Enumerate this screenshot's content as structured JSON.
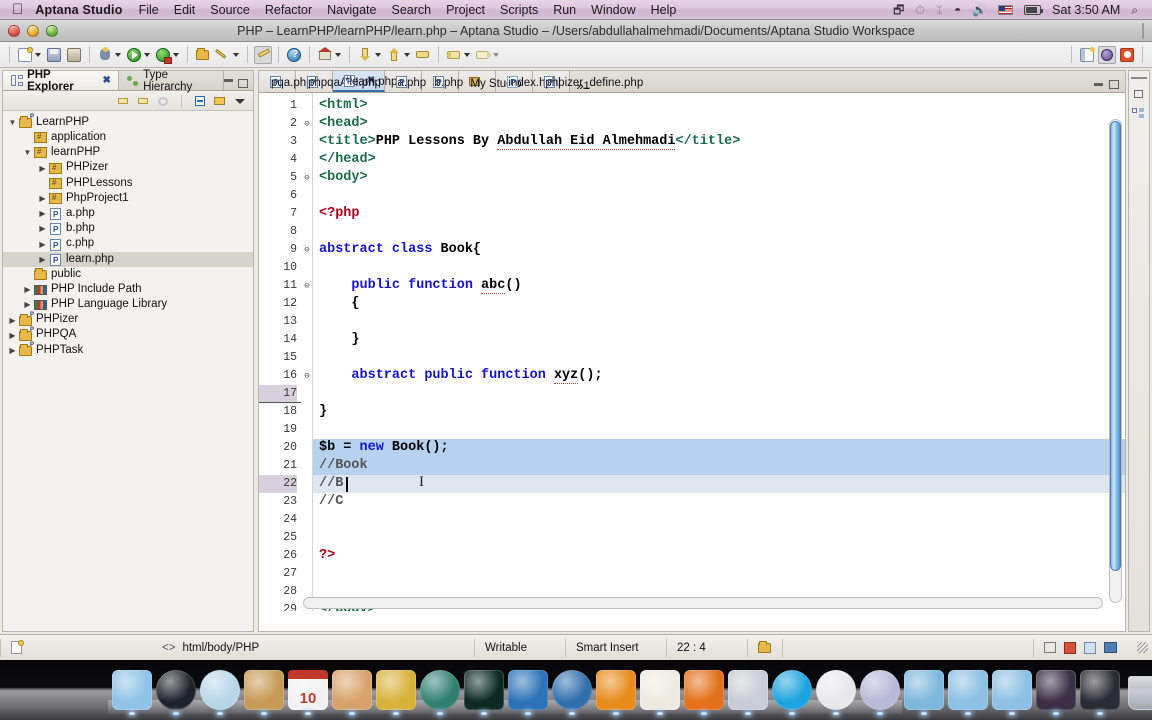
{
  "menubar": {
    "apple_glyph": "",
    "app_name": "Aptana Studio",
    "items": [
      "File",
      "Edit",
      "Source",
      "Refactor",
      "Navigate",
      "Search",
      "Project",
      "Scripts",
      "Run",
      "Window",
      "Help"
    ],
    "status_icons": [
      "airplay-icon",
      "timemachine-icon",
      "bluetooth-icon",
      "wifi-icon",
      "volume-icon",
      "flag-icon",
      "battery-icon"
    ],
    "clock": "Sat 3:50 AM",
    "search_glyph": "⌕"
  },
  "window": {
    "title": "PHP – LearnPHP/learnPHP/learn.php – Aptana Studio – /Users/abdullahalmehmadi/Documents/Aptana Studio Workspace"
  },
  "toolbar": {
    "groups": [
      [
        "new-wizard-icon",
        "save-icon",
        "print-icon"
      ],
      [
        "debug-icon",
        "run-icon",
        "profile-icon"
      ],
      [
        "open-resource-icon",
        "search-icon"
      ],
      [
        "edit-highlight-icon"
      ],
      [
        "help-icon"
      ],
      [
        "home-icon"
      ],
      [
        "next-annotation-icon",
        "previous-annotation-icon",
        "last-edit-icon"
      ],
      [
        "back-icon",
        "forward-icon"
      ]
    ],
    "perspectives": [
      "open-perspective-icon",
      "web-perspective-icon",
      "php-perspective-icon"
    ]
  },
  "explorer": {
    "tabs": [
      {
        "label": "PHP Explorer",
        "icon": "php-explorer-icon",
        "active": true,
        "closable": true
      },
      {
        "label": "Type Hierarchy",
        "icon": "type-hierarchy-icon",
        "active": false,
        "closable": false
      }
    ],
    "view_tools": [
      "back-icon",
      "forward-icon",
      "refresh-icon",
      "collapse-all-icon",
      "link-editor-icon",
      "view-menu-icon"
    ],
    "tree": [
      {
        "label": "LearnPHP",
        "depth": 0,
        "twist": "open",
        "icon": "project-folder",
        "selected": false
      },
      {
        "label": "application",
        "depth": 1,
        "twist": "none",
        "icon": "web-folder",
        "selected": false
      },
      {
        "label": "learnPHP",
        "depth": 1,
        "twist": "open",
        "icon": "web-folder",
        "selected": false
      },
      {
        "label": "PHPizer",
        "depth": 2,
        "twist": "close",
        "icon": "web-folder",
        "selected": false
      },
      {
        "label": "PHPLessons",
        "depth": 2,
        "twist": "none",
        "icon": "web-folder",
        "selected": false
      },
      {
        "label": "PhpProject1",
        "depth": 2,
        "twist": "close",
        "icon": "web-folder",
        "selected": false
      },
      {
        "label": "a.php",
        "depth": 2,
        "twist": "close",
        "icon": "php-file",
        "selected": false
      },
      {
        "label": "b.php",
        "depth": 2,
        "twist": "close",
        "icon": "php-file",
        "selected": false
      },
      {
        "label": "c.php",
        "depth": 2,
        "twist": "close",
        "icon": "php-file",
        "selected": false
      },
      {
        "label": "learn.php",
        "depth": 2,
        "twist": "close",
        "icon": "php-file",
        "selected": true
      },
      {
        "label": "public",
        "depth": 1,
        "twist": "none",
        "icon": "folder",
        "selected": false
      },
      {
        "label": "PHP Include Path",
        "depth": 1,
        "twist": "close",
        "icon": "library",
        "selected": false
      },
      {
        "label": "PHP Language Library",
        "depth": 1,
        "twist": "close",
        "icon": "library",
        "selected": false
      },
      {
        "label": "PHPizer",
        "depth": 0,
        "twist": "close",
        "icon": "project-folder",
        "selected": false
      },
      {
        "label": "PHPQA",
        "depth": 0,
        "twist": "close",
        "icon": "project-folder",
        "selected": false
      },
      {
        "label": "PHPTask",
        "depth": 0,
        "twist": "close",
        "icon": "project-folder",
        "selected": false
      }
    ]
  },
  "editor": {
    "tabs": [
      {
        "label": "pqa.php",
        "icon": "php-file",
        "active": false,
        "closable": false
      },
      {
        "label": "phpqaAPI.php",
        "icon": "php-file",
        "active": false,
        "closable": false
      },
      {
        "label": "*learn.php",
        "icon": "php-file",
        "active": true,
        "closable": true
      },
      {
        "label": "a.php",
        "icon": "php-file",
        "active": false,
        "closable": false
      },
      {
        "label": "b.php",
        "icon": "php-file",
        "active": false,
        "closable": false
      },
      {
        "label": "My Studio",
        "icon": "studio",
        "active": false,
        "closable": false
      },
      {
        "label": "index.html",
        "icon": "html-file",
        "active": false,
        "closable": false
      },
      {
        "label": "phpizer_define.php",
        "icon": "php-file",
        "active": false,
        "closable": false
      }
    ],
    "overflow_label": "1",
    "overflow_glyph": "»",
    "lines": [
      {
        "n": 1,
        "fold": "",
        "state": "normal",
        "tokens": [
          {
            "t": "<html>",
            "c": "tag"
          }
        ]
      },
      {
        "n": 2,
        "fold": "-",
        "state": "normal",
        "tokens": [
          {
            "t": "<head>",
            "c": "tag"
          }
        ]
      },
      {
        "n": 3,
        "fold": "",
        "state": "normal",
        "tokens": [
          {
            "t": "<title>",
            "c": "tag"
          },
          {
            "t": "PHP Lessons By ",
            "c": "txt"
          },
          {
            "t": "Abdullah Eid Almehmadi",
            "c": "txt spell"
          },
          {
            "t": "</title>",
            "c": "tag"
          }
        ]
      },
      {
        "n": 4,
        "fold": "",
        "state": "normal",
        "tokens": [
          {
            "t": "</head>",
            "c": "tag"
          }
        ]
      },
      {
        "n": 5,
        "fold": "-",
        "state": "normal",
        "tokens": [
          {
            "t": "<body>",
            "c": "tag"
          }
        ]
      },
      {
        "n": 6,
        "fold": "",
        "state": "normal",
        "tokens": []
      },
      {
        "n": 7,
        "fold": "",
        "state": "normal",
        "tokens": [
          {
            "t": "<?php",
            "c": "php"
          }
        ]
      },
      {
        "n": 8,
        "fold": "",
        "state": "normal",
        "tokens": []
      },
      {
        "n": 9,
        "fold": "-",
        "state": "normal",
        "tokens": [
          {
            "t": "abstract class ",
            "c": "kw"
          },
          {
            "t": "Book{",
            "c": "txt"
          }
        ]
      },
      {
        "n": 10,
        "fold": "",
        "state": "normal",
        "tokens": []
      },
      {
        "n": 11,
        "fold": "-",
        "state": "normal",
        "tokens": [
          {
            "t": "    public function ",
            "c": "kw"
          },
          {
            "t": "abc",
            "c": "txt spell"
          },
          {
            "t": "()",
            "c": "txt"
          }
        ]
      },
      {
        "n": 12,
        "fold": "",
        "state": "normal",
        "tokens": [
          {
            "t": "    {",
            "c": "txt"
          }
        ]
      },
      {
        "n": 13,
        "fold": "",
        "state": "normal",
        "tokens": []
      },
      {
        "n": 14,
        "fold": "",
        "state": "normal",
        "tokens": [
          {
            "t": "    }",
            "c": "txt"
          }
        ]
      },
      {
        "n": 15,
        "fold": "",
        "state": "normal",
        "tokens": []
      },
      {
        "n": 16,
        "fold": "-",
        "state": "normal",
        "tokens": [
          {
            "t": "    abstract public function ",
            "c": "kw"
          },
          {
            "t": "xyz",
            "c": "txt spell"
          },
          {
            "t": "();",
            "c": "txt"
          }
        ]
      },
      {
        "n": 17,
        "fold": "",
        "state": "fold-end",
        "tokens": []
      },
      {
        "n": 18,
        "fold": "",
        "state": "normal",
        "tokens": [
          {
            "t": "}",
            "c": "txt"
          }
        ]
      },
      {
        "n": 19,
        "fold": "",
        "state": "normal",
        "tokens": []
      },
      {
        "n": 20,
        "fold": "",
        "state": "selected",
        "tokens": [
          {
            "t": "$b",
            "c": "var"
          },
          {
            "t": " = ",
            "c": "txt"
          },
          {
            "t": "new",
            "c": "kw"
          },
          {
            "t": " Book();",
            "c": "txt"
          }
        ]
      },
      {
        "n": 21,
        "fold": "",
        "state": "selected",
        "tokens": [
          {
            "t": "//Book",
            "c": "cmt"
          }
        ]
      },
      {
        "n": 22,
        "fold": "",
        "state": "current",
        "tokens": [
          {
            "t": "//B",
            "c": "cmt"
          }
        ]
      },
      {
        "n": 23,
        "fold": "",
        "state": "normal",
        "tokens": [
          {
            "t": "//C",
            "c": "cmt"
          }
        ]
      },
      {
        "n": 24,
        "fold": "",
        "state": "normal",
        "tokens": []
      },
      {
        "n": 25,
        "fold": "",
        "state": "normal",
        "tokens": []
      },
      {
        "n": 26,
        "fold": "",
        "state": "normal",
        "tokens": [
          {
            "t": "?>",
            "c": "php"
          }
        ]
      },
      {
        "n": 27,
        "fold": "",
        "state": "normal",
        "tokens": []
      },
      {
        "n": 28,
        "fold": "",
        "state": "normal",
        "tokens": []
      },
      {
        "n": 29,
        "fold": "",
        "state": "normal",
        "tokens": [
          {
            "t": "</body>",
            "c": "tag"
          }
        ]
      }
    ]
  },
  "statusbar": {
    "breadcrumb_glyph": "<>",
    "breadcrumb": "html/body/PHP",
    "writable": "Writable",
    "insert_mode": "Smart Insert",
    "position": "22 : 4",
    "right_icons": [
      "tasks-icon",
      "warning-icon",
      "validation-icon",
      "console-icon"
    ]
  },
  "dock": {
    "items": [
      {
        "name": "finder",
        "color": "#8fc3e8"
      },
      {
        "name": "dashboard",
        "color": "#1e2229"
      },
      {
        "name": "safari",
        "color": "#b8d6ea"
      },
      {
        "name": "address-book",
        "color": "#c79a55"
      },
      {
        "name": "ical",
        "color": "#f2f2f2",
        "label": "10"
      },
      {
        "name": "iphoto",
        "color": "#d8a36a"
      },
      {
        "name": "imovie",
        "color": "#d9b23a"
      },
      {
        "name": "time-machine",
        "color": "#2f7f70"
      },
      {
        "name": "zain",
        "color": "#0b2b22"
      },
      {
        "name": "aptana",
        "color": "#2a73b8"
      },
      {
        "name": "quicktime-x",
        "color": "#2f6fae"
      },
      {
        "name": "system-prefs",
        "color": "#e88b1a"
      },
      {
        "name": "textedit",
        "color": "#eeeae0"
      },
      {
        "name": "firefox",
        "color": "#e4711a"
      },
      {
        "name": "photobooth",
        "color": "#c9cdd4"
      },
      {
        "name": "quicktime",
        "color": "#1ba3e0"
      },
      {
        "name": "cyberduck",
        "color": "#e8e8ea"
      },
      {
        "name": "itunes",
        "color": "#b8b8d8"
      },
      {
        "name": "app-store",
        "color": "#7fb8dd"
      },
      {
        "name": "applications-folder",
        "color": "#8cc0e4"
      },
      {
        "name": "documents-folder",
        "color": "#8cc0e4"
      },
      {
        "name": "screen-window",
        "color": "#3a2f44"
      },
      {
        "name": "stack-grid",
        "color": "#2b2b33"
      }
    ],
    "trash": "trash-icon"
  }
}
